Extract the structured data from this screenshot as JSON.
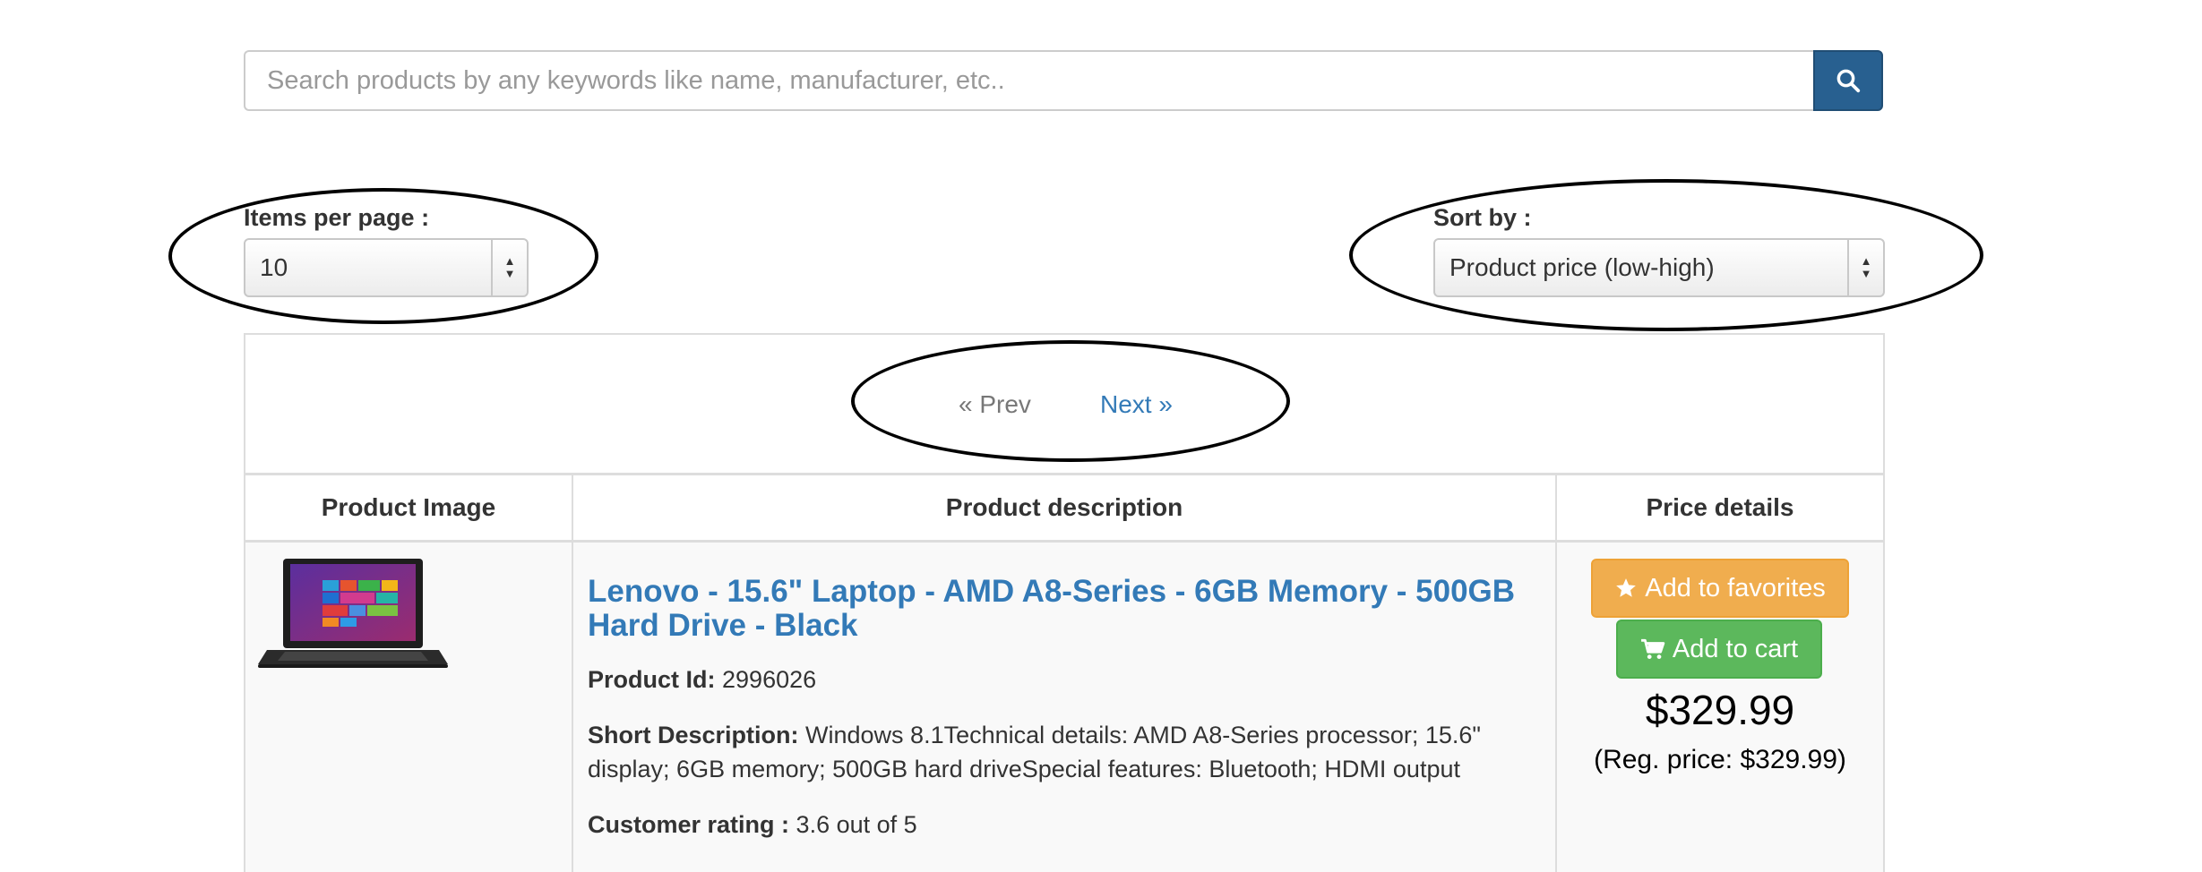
{
  "search": {
    "placeholder": "Search products by any keywords like name, manufacturer, etc..",
    "value": ""
  },
  "controls": {
    "items_per_page_label": "Items per page :",
    "items_per_page_value": "10",
    "sort_by_label": "Sort by :",
    "sort_by_value": "Product price (low-high)"
  },
  "pager": {
    "prev_label": "« Prev",
    "next_label": "Next »"
  },
  "table": {
    "headers": [
      "Product Image",
      "Product description",
      "Price details"
    ],
    "rows": [
      {
        "title": "Lenovo - 15.6\" Laptop - AMD A8-Series - 6GB Memory - 500GB Hard Drive - Black",
        "product_id_label": "Product Id:",
        "product_id": "2996026",
        "short_desc_label": "Short Description:",
        "short_desc": "Windows 8.1Technical details: AMD A8-Series processor; 15.6\" display; 6GB memory; 500GB hard driveSpecial features: Bluetooth; HDMI output",
        "rating_label": "Customer rating :",
        "rating": "3.6 out of 5",
        "favorites_label": "Add to favorites",
        "cart_label": "Add to cart",
        "price": "$329.99",
        "reg_price": "(Reg. price: $329.99)"
      }
    ]
  },
  "colors": {
    "link": "#337ab7",
    "primary_button": "#286090",
    "warning_button": "#f0ad4e",
    "success_button": "#5cb85c"
  },
  "icons": {
    "search": "search-icon",
    "favorites": "star-icon",
    "cart": "cart-icon",
    "select": "updown-arrows-icon"
  }
}
